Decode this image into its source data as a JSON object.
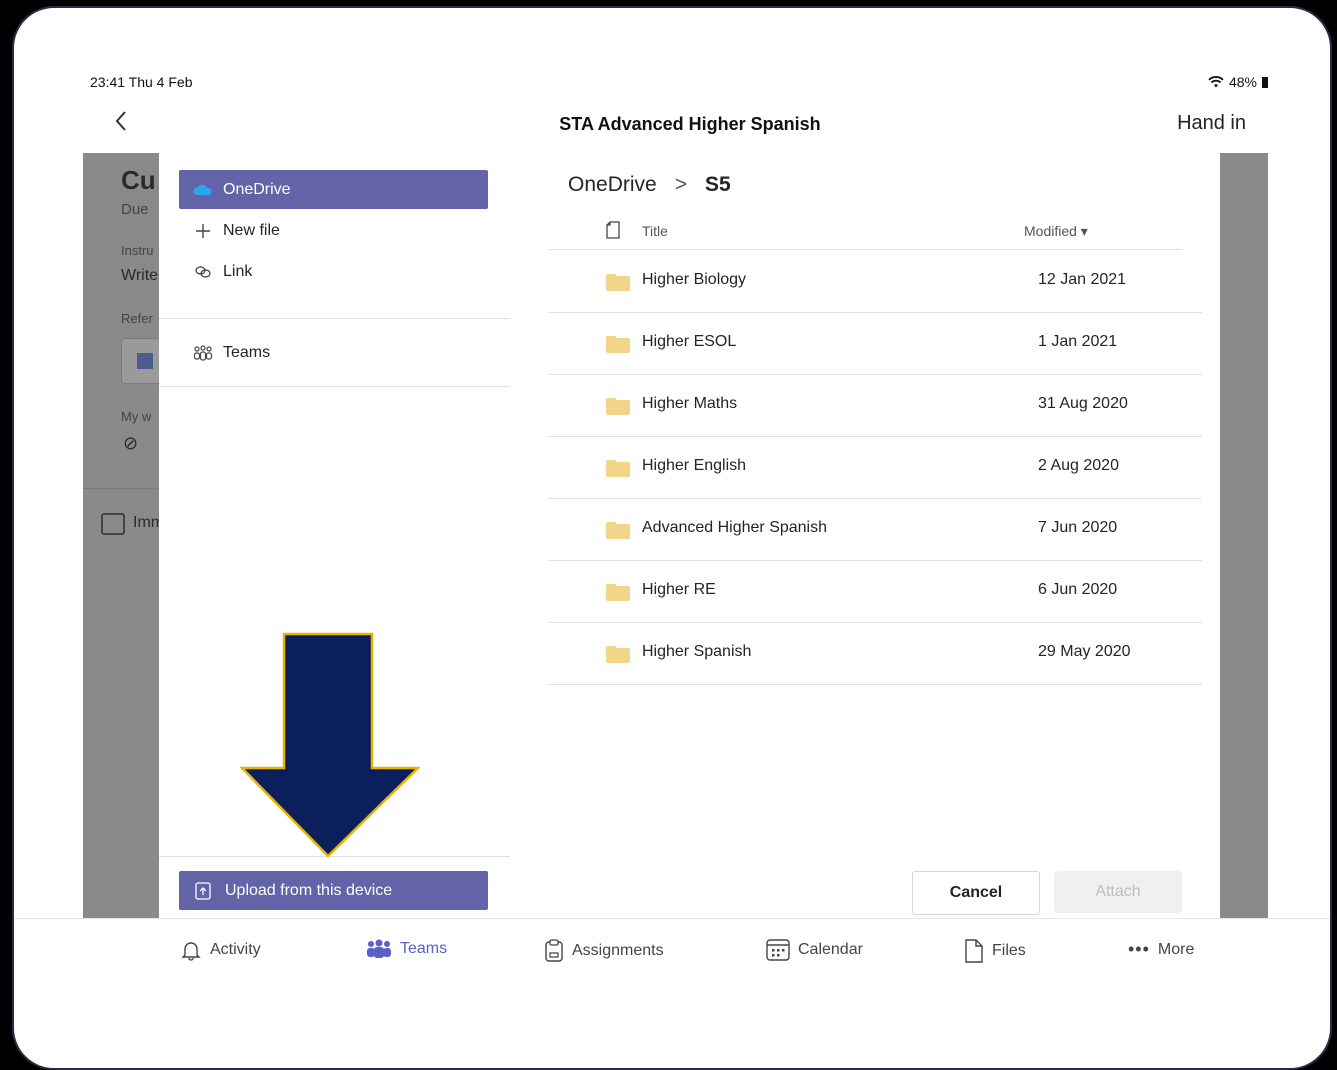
{
  "status": {
    "time": "23:41  Thu 4 Feb",
    "battery": "48%"
  },
  "header": {
    "title": "STA Advanced Higher Spanish",
    "hand_in": "Hand in"
  },
  "background": {
    "title_partial": "Cu",
    "due_partial": "Due",
    "instructions_partial": "Instru",
    "write_partial": "Write",
    "reference_partial": "Refer",
    "my_work_partial": "My w",
    "immersive_partial": "Imm"
  },
  "sidebar": {
    "items": [
      {
        "label": "OneDrive",
        "icon": "cloud-icon",
        "selected": true
      },
      {
        "label": "New file",
        "icon": "plus-icon",
        "selected": false
      },
      {
        "label": "Link",
        "icon": "link-icon",
        "selected": false
      },
      {
        "label": "Teams",
        "icon": "teams-icon",
        "selected": false
      }
    ],
    "upload_label": "Upload from this device"
  },
  "browser": {
    "breadcrumb": {
      "root": "OneDrive",
      "separator": ">",
      "current": "S5"
    },
    "columns": {
      "title": "Title",
      "modified": "Modified ▾"
    },
    "rows": [
      {
        "name": "Higher Biology",
        "date": "12 Jan 2021"
      },
      {
        "name": "Higher ESOL",
        "date": "1 Jan 2021"
      },
      {
        "name": "Higher Maths",
        "date": "31 Aug 2020"
      },
      {
        "name": "Higher English",
        "date": "2 Aug 2020"
      },
      {
        "name": "Advanced Higher Spanish",
        "date": "7 Jun 2020"
      },
      {
        "name": "Higher RE",
        "date": "6 Jun 2020"
      },
      {
        "name": "Higher Spanish",
        "date": "29 May 2020"
      }
    ],
    "cancel_label": "Cancel",
    "attach_label": "Attach"
  },
  "tabbar": {
    "tabs": [
      {
        "label": "Activity",
        "icon": "bell-icon"
      },
      {
        "label": "Teams",
        "icon": "teams-icon",
        "active": true
      },
      {
        "label": "Assignments",
        "icon": "assignments-icon"
      },
      {
        "label": "Calendar",
        "icon": "calendar-icon"
      },
      {
        "label": "Files",
        "icon": "file-icon"
      },
      {
        "label": "More",
        "icon": "more-icon"
      }
    ]
  },
  "colors": {
    "accent": "#6264a7",
    "arrow_fill": "#0b1f5c",
    "arrow_outline": "#e6b400",
    "folder": "#f3d58a"
  }
}
